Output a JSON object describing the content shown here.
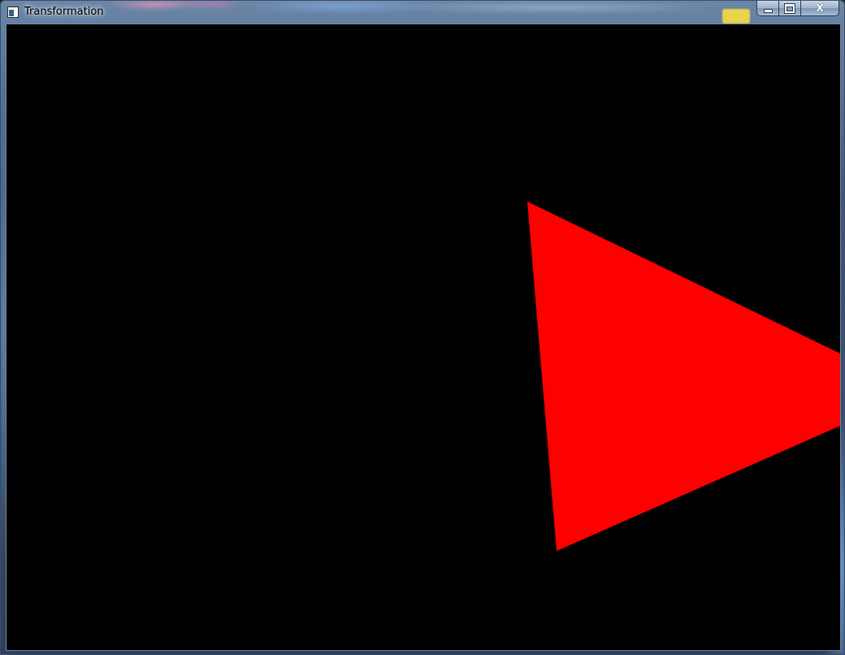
{
  "window": {
    "title": "Transformation",
    "icon": "window-app-icon",
    "caption_buttons": {
      "minimize_icon": "minimize-icon",
      "maximize_icon": "maximize-icon",
      "close_glyph": "X"
    }
  },
  "canvas": {
    "background_color": "#000000",
    "shape": "triangle",
    "fill_color": "#ff0000"
  }
}
